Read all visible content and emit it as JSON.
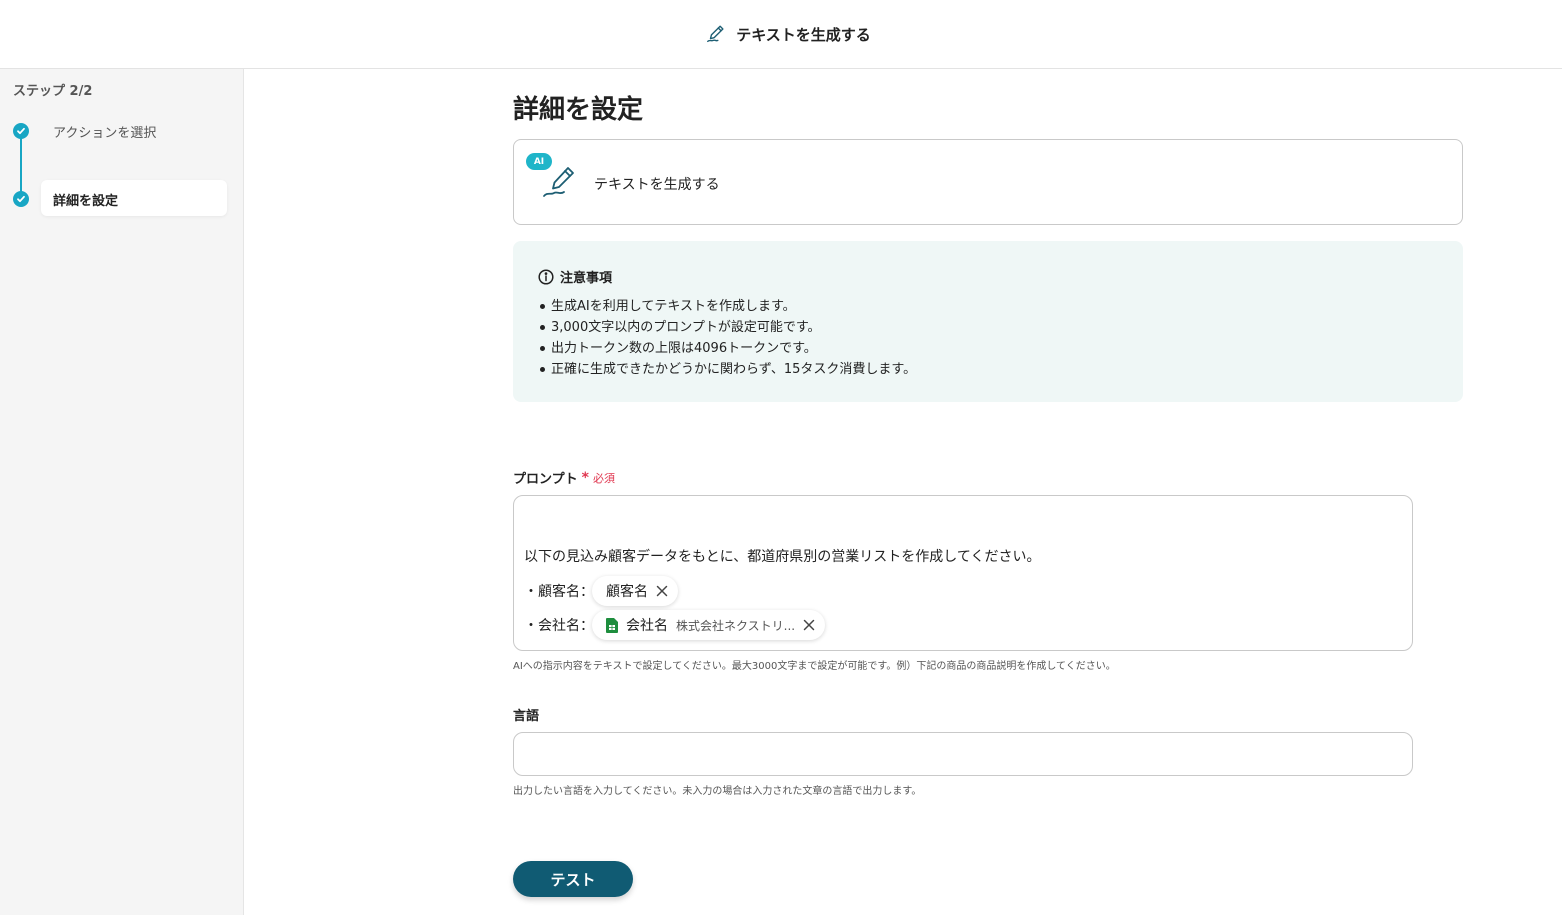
{
  "header": {
    "title": "テキストを生成する",
    "icon": "pen-write-icon"
  },
  "sidebar": {
    "step_count": "ステップ 2/2",
    "steps": [
      {
        "label": "アクションを選択",
        "status": "done"
      },
      {
        "label": "詳細を設定",
        "status": "current"
      }
    ]
  },
  "main": {
    "page_title": "詳細を設定",
    "action_card": {
      "badge": "AI",
      "label": "テキストを生成する"
    },
    "notice": {
      "title": "注意事項",
      "items": [
        "生成AIを利用してテキストを作成します。",
        "3,000文字以内のプロンプトが設定可能です。",
        "出力トークン数の上限は4096トークンです。",
        "正確に生成できたかどうかに関わらず、15タスク消費します。"
      ]
    },
    "prompt": {
      "label": "プロンプト",
      "required_mark": "*",
      "required_text": "必須",
      "line1": "以下の見込み顧客データをもとに、都道府県別の営業リストを作成してください。",
      "customer_label": "・顧客名：",
      "customer_chip": "顧客名",
      "company_label": "・会社名：",
      "company_chip": "会社名",
      "company_chip_value": "株式会社ネクストリ...",
      "help": "AIへの指示内容をテキストで設定してください。最大3000文字まで設定が可能です。例）下記の商品の商品説明を作成してください。"
    },
    "language": {
      "label": "言語",
      "value": "",
      "placeholder": "",
      "help": "出力したい言語を入力してください。未入力の場合は入力された文章の言語で出力します。"
    },
    "test_button": "テスト"
  },
  "colors": {
    "accent": "#18a6c4",
    "ai_badge": "#1fb5c9",
    "notice_bg": "#eff7f6",
    "required": "#e0364f",
    "primary_button": "#105b73",
    "sheets_green": "#1e8e3e"
  }
}
